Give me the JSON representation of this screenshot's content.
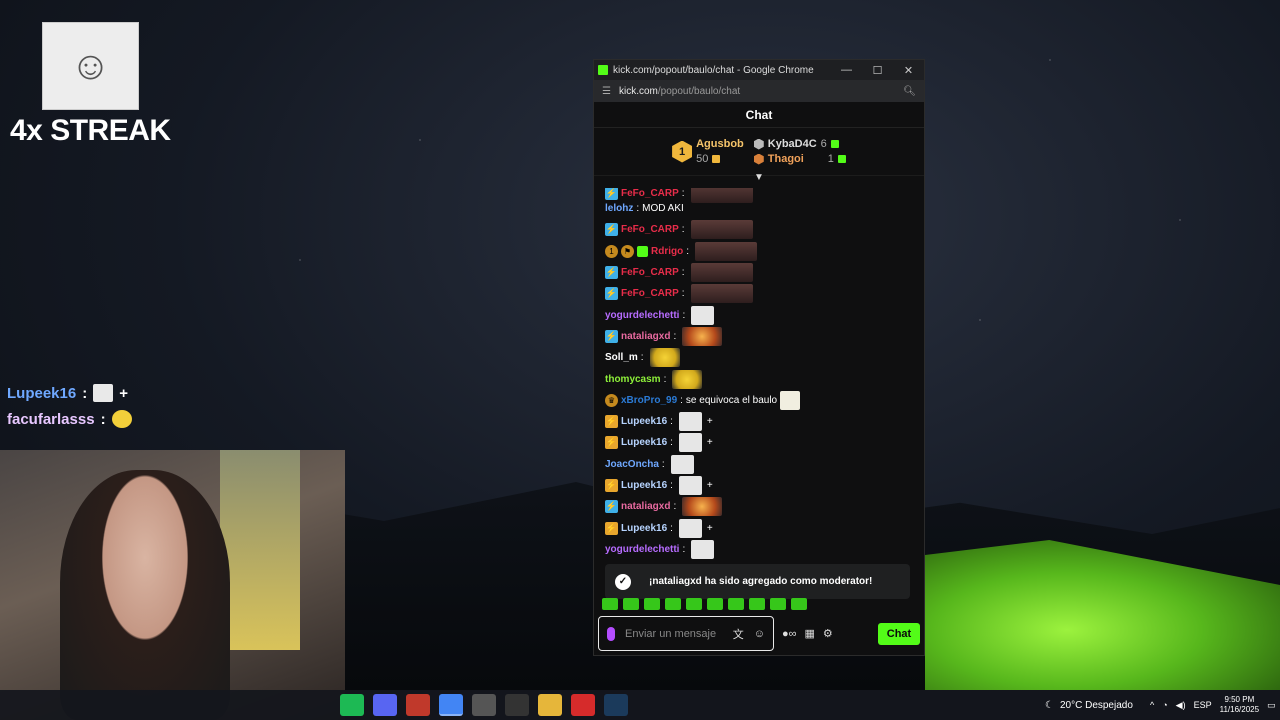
{
  "overlay": {
    "streak": "4x STREAK",
    "chat": [
      {
        "user": "Lupeek16",
        "sep": ":",
        "suffix": "+"
      },
      {
        "user": "facufarlasss",
        "sep": ":"
      }
    ]
  },
  "window": {
    "title": "kick.com/popout/baulo/chat - Google Chrome",
    "url_host": "kick.com",
    "url_path": "/popout/baulo/chat",
    "minimize": "—",
    "maximize": "☐",
    "close": "✕"
  },
  "chat": {
    "header": "Chat",
    "leaderboard": {
      "first": {
        "rank": "1",
        "name": "Agusbob",
        "count": "50"
      },
      "second": {
        "name": "KybaD4C",
        "count": "6"
      },
      "third": {
        "name": "Thagoi",
        "count": "1"
      }
    },
    "messages": [
      {
        "badges": [
          "mod"
        ],
        "user": "FeFo_CARP",
        "color": "#e82d4a",
        "text": "",
        "emote": "dark",
        "partial": true
      },
      {
        "badges": [],
        "user": "lelohz",
        "color": "#6fa8ff",
        "text": "MOD AKI",
        "emote": ""
      },
      {
        "badges": [
          "mod"
        ],
        "user": "FeFo_CARP",
        "color": "#e82d4a",
        "text": "",
        "emote": "dark"
      },
      {
        "badges": [
          "og",
          "flag",
          "gift"
        ],
        "user": "Rdrigo",
        "color": "#e82d4a",
        "text": "",
        "emote": "dark"
      },
      {
        "badges": [
          "mod"
        ],
        "user": "FeFo_CARP",
        "color": "#e82d4a",
        "text": "",
        "emote": "dark"
      },
      {
        "badges": [
          "mod"
        ],
        "user": "FeFo_CARP",
        "color": "#e82d4a",
        "text": "",
        "emote": "dark"
      },
      {
        "badges": [],
        "user": "yogurdelechetti",
        "color": "#b76cff",
        "text": "",
        "emote": "meme"
      },
      {
        "badges": [
          "mod"
        ],
        "user": "nataliagxd",
        "color": "#e86aa0",
        "text": "",
        "emote": "fire"
      },
      {
        "badges": [],
        "user": "Soll_m",
        "color": "#ffffff",
        "text": "",
        "emote": "minion"
      },
      {
        "badges": [],
        "user": "thomycasm",
        "color": "#8ef03a",
        "text": "",
        "emote": "minion"
      },
      {
        "badges": [
          "crown"
        ],
        "user": "xBroPro_99",
        "color": "#2b7bd6",
        "text": "se equivoca el baulo",
        "emote": "person"
      },
      {
        "badges": [
          "sub"
        ],
        "user": "Lupeek16",
        "color": "#b7d4ff",
        "text": "",
        "emote": "meme",
        "plus": "+"
      },
      {
        "badges": [
          "sub"
        ],
        "user": "Lupeek16",
        "color": "#b7d4ff",
        "text": "",
        "emote": "meme",
        "plus": "+"
      },
      {
        "badges": [],
        "user": "JoacOncha",
        "color": "#6fa8ff",
        "text": "",
        "emote": "meme"
      },
      {
        "badges": [
          "sub"
        ],
        "user": "Lupeek16",
        "color": "#b7d4ff",
        "text": "",
        "emote": "meme",
        "plus": "+"
      },
      {
        "badges": [
          "mod"
        ],
        "user": "nataliagxd",
        "color": "#e86aa0",
        "text": "",
        "emote": "fire"
      },
      {
        "badges": [
          "sub"
        ],
        "user": "Lupeek16",
        "color": "#b7d4ff",
        "text": "",
        "emote": "meme",
        "plus": "+"
      },
      {
        "badges": [],
        "user": "yogurdelechetti",
        "color": "#b76cff",
        "text": "",
        "emote": "meme"
      }
    ],
    "toast": "¡nataliagxd ha sido agregado como moderator!",
    "input_placeholder": "Enviar un mensaje",
    "send_label": "Chat",
    "accent": "#53fc18"
  },
  "taskbar": {
    "weather": "20°C  Despejado",
    "lang": "ESP",
    "time": "9:50 PM",
    "date": "11/16/2025"
  }
}
